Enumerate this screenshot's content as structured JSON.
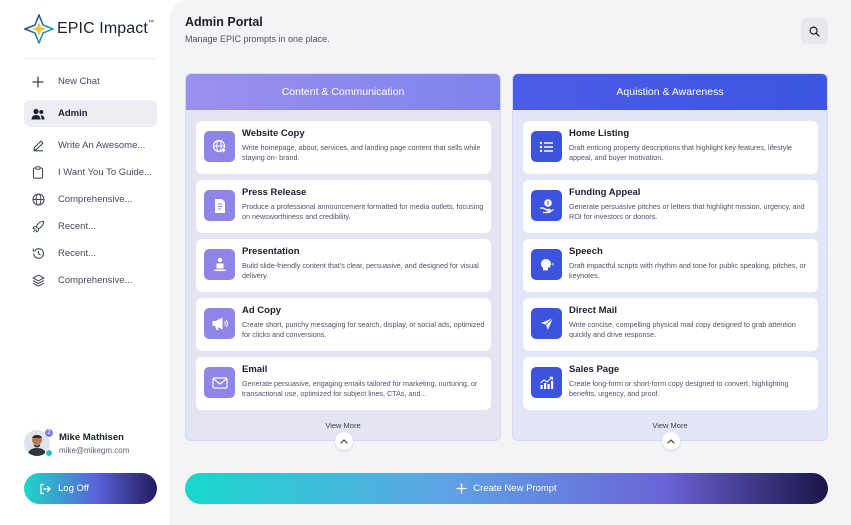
{
  "brand": {
    "name": "EPIC Impact",
    "tm": "™"
  },
  "sidebar": {
    "new_chat": {
      "label": "New Chat",
      "icon": "plus-icon"
    },
    "admin": {
      "label": "Admin",
      "icon": "users-icon"
    },
    "history": [
      {
        "label": "Write An Awesome...",
        "icon": "pen-icon"
      },
      {
        "label": "I Want You To Guide...",
        "icon": "clipboard-icon"
      },
      {
        "label": "Comprehensive...",
        "icon": "globe-icon"
      },
      {
        "label": "Recent...",
        "icon": "rocket-icon"
      },
      {
        "label": "Recent...",
        "icon": "history-icon"
      },
      {
        "label": "Comprehensive...",
        "icon": "layers-icon"
      }
    ]
  },
  "user": {
    "name": "Mike Mathisen",
    "email": "mike@mikegm.com",
    "badge": "2"
  },
  "logout": {
    "label": "Log Off"
  },
  "header": {
    "title": "Admin Portal",
    "subtitle": "Manage EPIC prompts in one place."
  },
  "panels": [
    {
      "title": "Content & Communication",
      "view_more": "View More",
      "cards": [
        {
          "title": "Website Copy",
          "desc": "Write homepage, about, services, and landing page content that sells while staying on- brand.",
          "icon": "globe-cursor-icon"
        },
        {
          "title": "Press Release",
          "desc": "Produce a professional announcement formatted for media outlets, focusing on newsworthiness and credibility.",
          "icon": "document-icon"
        },
        {
          "title": "Presentation",
          "desc": "Build slide-friendly content that's clear, persuasive, and designed for visual delivery.",
          "icon": "presenter-icon"
        },
        {
          "title": "Ad Copy",
          "desc": "Create short, punchy messaging for search, display, or social ads, optimized for clicks and conversions.",
          "icon": "megaphone-icon"
        },
        {
          "title": "Email",
          "desc": "Generate persuasive, engaging emails tailored for marketing, nurturing, or transactional use, optimized for subject lines, CTAs, and...",
          "icon": "envelope-icon"
        }
      ]
    },
    {
      "title": "Aquistion & Awareness",
      "view_more": "View More",
      "cards": [
        {
          "title": "Home Listing",
          "desc": "Draft enticing property descriptions that highlight key features, lifestyle appeal, and buyer motivation.",
          "icon": "list-icon"
        },
        {
          "title": "Funding Appeal",
          "desc": "Generate persuasive pitches or letters that highlight mission, urgency, and ROI for investors or donors.",
          "icon": "hand-coin-icon"
        },
        {
          "title": "Speech",
          "desc": "Draft impactful scripts with rhythm and tone for public speaking, pitches, or keynotes.",
          "icon": "speaking-head-icon"
        },
        {
          "title": "Direct Mail",
          "desc": "Write concise, compelling physical mail copy designed to grab attention quickly and drive response.",
          "icon": "send-icon"
        },
        {
          "title": "Sales Page",
          "desc": "Create long-form or short-form copy designed to convert, highlighting benefits, urgency, and proof.",
          "icon": "chart-growth-icon"
        }
      ]
    }
  ],
  "create": {
    "label": "Create New Prompt"
  },
  "colors": {
    "accent": "#4a5de7",
    "accent_soft": "#8f84e8",
    "teal": "#1ed7c9"
  }
}
